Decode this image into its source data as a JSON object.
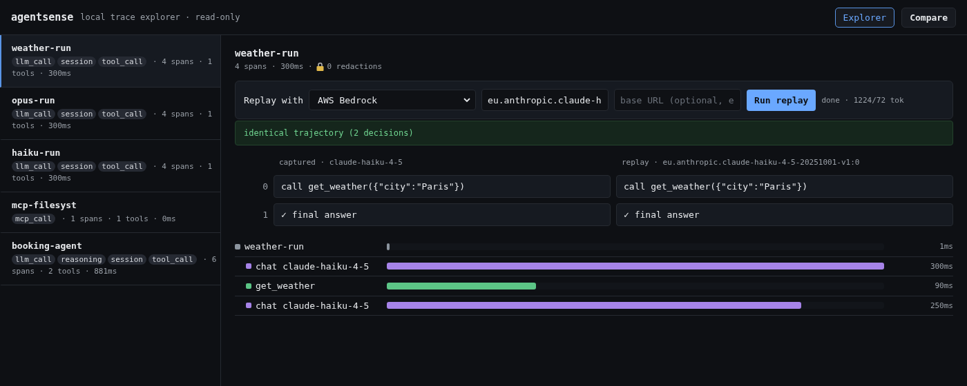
{
  "header": {
    "brand": "agentsense",
    "subtitle": "local trace explorer · read-only",
    "tabs": [
      {
        "label": "Explorer",
        "selected": true
      },
      {
        "label": "Compare",
        "selected": false
      }
    ]
  },
  "sidebar": {
    "items": [
      {
        "name": "weather-run",
        "selected": true,
        "tags": [
          "llm_call",
          "session",
          "tool_call"
        ],
        "meta_lines": [
          "· 4 spans · 1",
          "tools · 300ms"
        ]
      },
      {
        "name": "opus-run",
        "selected": false,
        "tags": [
          "llm_call",
          "session",
          "tool_call"
        ],
        "meta_lines": [
          "· 4 spans · 1",
          "tools · 300ms"
        ]
      },
      {
        "name": "haiku-run",
        "selected": false,
        "tags": [
          "llm_call",
          "session",
          "tool_call"
        ],
        "meta_lines": [
          "· 4 spans · 1",
          "tools · 300ms"
        ]
      },
      {
        "name": "mcp-filesyst",
        "selected": false,
        "tags": [
          "mcp_call"
        ],
        "meta_lines": [
          "· 1 spans · 1 tools · 0ms"
        ]
      },
      {
        "name": "booking-agent",
        "selected": false,
        "tags": [
          "llm_call",
          "reasoning",
          "session",
          "tool_call"
        ],
        "meta_lines": [
          "· 6",
          "spans · 2 tools · 881ms"
        ]
      }
    ]
  },
  "detail": {
    "title": "weather-run",
    "meta_before": "4 spans · 300ms ·",
    "meta_after": "0 redactions",
    "replay": {
      "label": "Replay with",
      "provider": "AWS Bedrock",
      "model": "eu.anthropic.claude-h",
      "base_url_placeholder": "base URL (optional, e",
      "button": "Run replay",
      "status": "done · 1224/72 tok"
    },
    "result": "identical trajectory (2 decisions)",
    "compare": {
      "captured_heading": "captured · claude-haiku-4-5",
      "replay_heading": "replay · eu.anthropic.claude-haiku-4-5-20251001-v1:0",
      "rows": [
        {
          "index": "0",
          "captured": "call get_weather({\"city\":\"Paris\"})",
          "replay": "call get_weather({\"city\":\"Paris\"})"
        },
        {
          "index": "1",
          "captured": "✓ final answer",
          "replay": "✓ final answer"
        }
      ]
    },
    "spans": [
      {
        "name": "weather-run",
        "color": "#8b949e",
        "level": 0.006,
        "duration": "1ms",
        "children": [
          {
            "name": "chat claude-haiku-4-5",
            "color": "#a683e8",
            "level": 1,
            "duration": "300ms"
          },
          {
            "name": "get_weather",
            "color": "#5cc586",
            "level": 0.3,
            "duration": "90ms"
          },
          {
            "name": "chat claude-haiku-4-5",
            "color": "#a683e8",
            "level": 0.833,
            "duration": "250ms"
          }
        ]
      }
    ]
  }
}
